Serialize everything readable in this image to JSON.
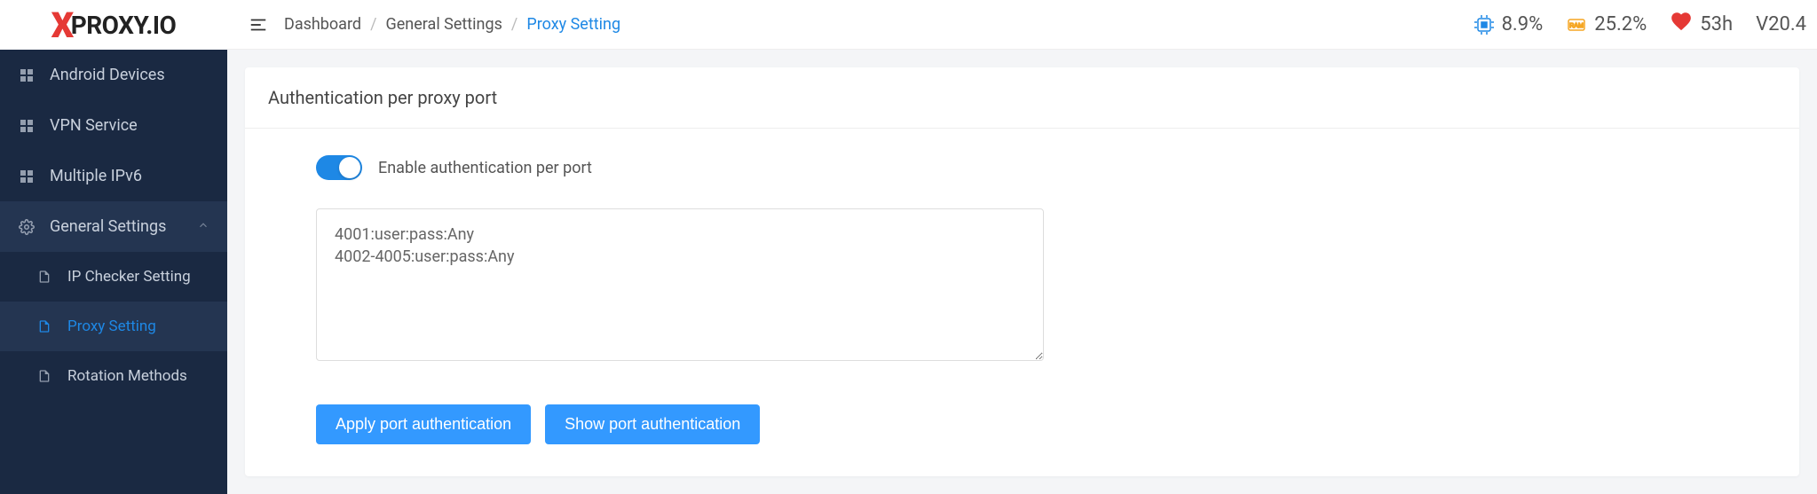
{
  "logo": {
    "x": "X",
    "text": "PROXY.IO"
  },
  "sidebar": {
    "items": [
      {
        "label": "Android Devices"
      },
      {
        "label": "VPN Service"
      },
      {
        "label": "Multiple IPv6"
      },
      {
        "label": "General Settings"
      }
    ],
    "subitems": [
      {
        "label": "IP Checker Setting"
      },
      {
        "label": "Proxy Setting"
      },
      {
        "label": "Rotation Methods"
      }
    ]
  },
  "breadcrumb": {
    "items": [
      "Dashboard",
      "General Settings",
      "Proxy Setting"
    ]
  },
  "stats": {
    "cpu_icon_label": "CPU",
    "cpu_value": "8.9%",
    "ram_icon_label": "RAM",
    "ram_value": "25.2%",
    "uptime": "53h",
    "version": "V20.4"
  },
  "card": {
    "title": "Authentication per proxy port",
    "toggle_label": "Enable authentication per port",
    "toggle_on": true,
    "textarea_value": "4001:user:pass:Any\n4002-4005:user:pass:Any",
    "apply_button": "Apply port authentication",
    "show_button": "Show port authentication"
  }
}
